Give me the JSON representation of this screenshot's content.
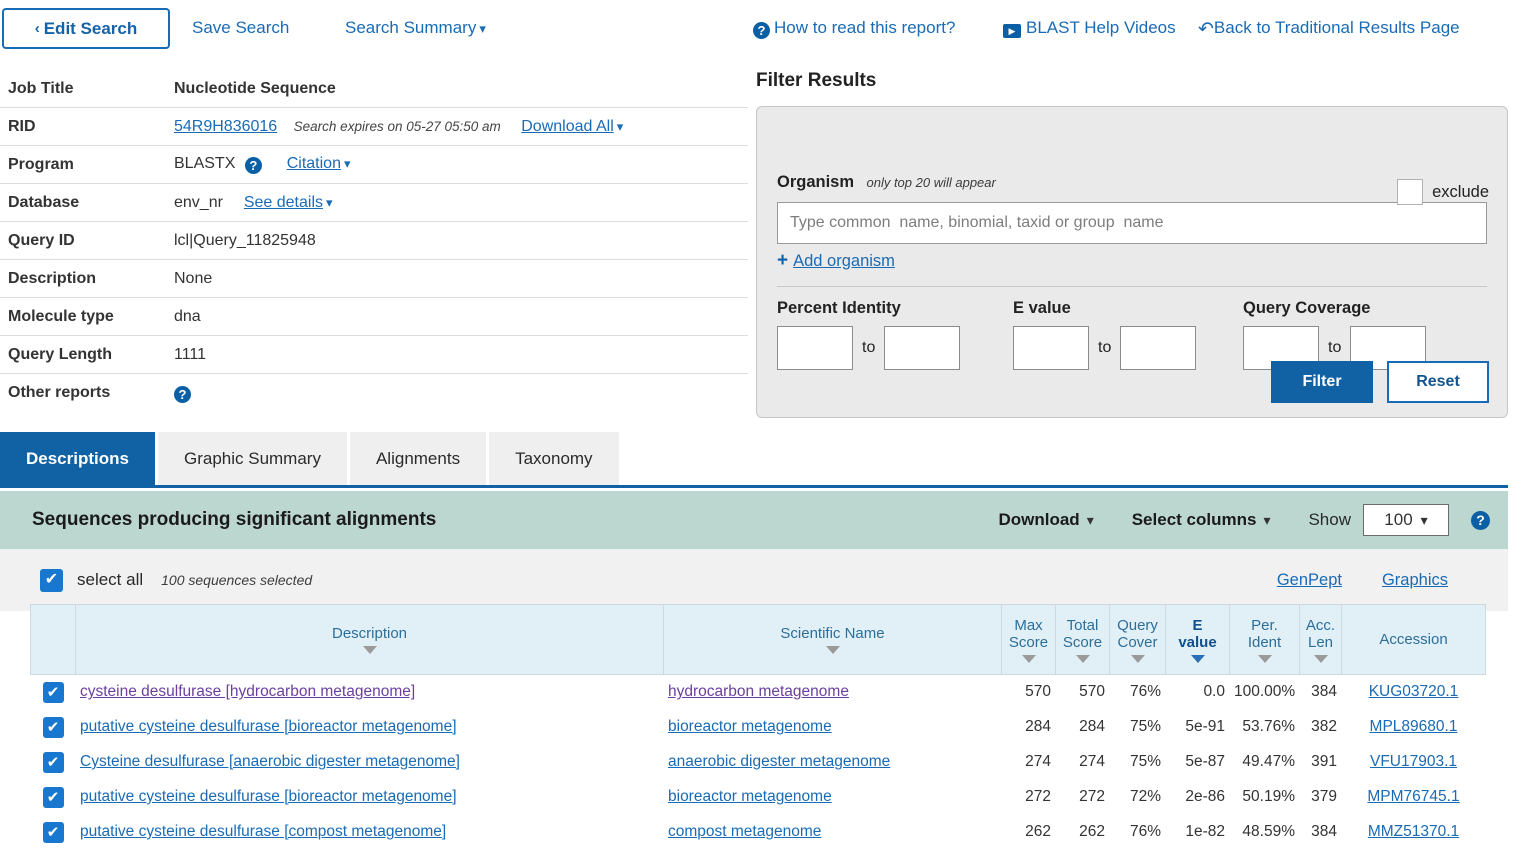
{
  "toolbar": {
    "edit_search": "Edit Search",
    "save_search": "Save Search",
    "search_summary": "Search Summary",
    "how_to_read": "How to read this report?",
    "help_videos": "BLAST Help Videos",
    "back_traditional": "Back to Traditional Results Page",
    "caret": "⌄"
  },
  "summary": {
    "rows": [
      {
        "label": "Job Title",
        "value": "Nucleotide Sequence"
      },
      {
        "label": "RID",
        "value": "54R9H836016",
        "note": "Search expires on 05-27 05:50 am",
        "link": "Download All"
      },
      {
        "label": "Program",
        "value": "BLASTX",
        "link": "Citation"
      },
      {
        "label": "Database",
        "value": "env_nr",
        "link": "See details"
      },
      {
        "label": "Query ID",
        "value": "lcl|Query_11825948"
      },
      {
        "label": "Description",
        "value": "None"
      },
      {
        "label": "Molecule type",
        "value": "dna"
      },
      {
        "label": "Query Length",
        "value": "1111"
      },
      {
        "label": "Other reports",
        "value": ""
      }
    ]
  },
  "filter": {
    "title": "Filter Results",
    "organism_label": "Organism",
    "organism_hint": "only top 20 will appear",
    "organism_placeholder": "Type common  name, binomial, taxid or group  name",
    "organism_value": "",
    "exclude_label": "exclude",
    "add_organism": "Add organism",
    "percent_identity_label": "Percent Identity",
    "evalue_label": "E value",
    "query_coverage_label": "Query Coverage",
    "to_label": "to",
    "pi_from": "",
    "pi_to": "",
    "ev_from": "",
    "ev_to": "",
    "qc_from": "",
    "qc_to": "",
    "filter_button": "Filter",
    "reset_button": "Reset",
    "accent": "#1161a5"
  },
  "tabs": [
    {
      "label": "Descriptions",
      "active": true
    },
    {
      "label": "Graphic Summary",
      "active": false
    },
    {
      "label": "Alignments",
      "active": false
    },
    {
      "label": "Taxonomy",
      "active": false
    }
  ],
  "results_band": {
    "title": "Sequences producing significant alignments",
    "download": "Download",
    "select_columns": "Select columns",
    "show_label": "Show",
    "show_value": "100",
    "band_color": "#bcd6d0"
  },
  "select_strip": {
    "select_all_label": "select all",
    "selected_count": "100 sequences selected",
    "genpept": "GenPept",
    "graphics": "Graphics"
  },
  "table": {
    "columns": [
      {
        "label": "",
        "key": "chk"
      },
      {
        "label": "Description",
        "key": "desc",
        "sortable": true
      },
      {
        "label": "Scientific Name",
        "key": "sci",
        "sortable": true
      },
      {
        "label": "Max\nScore",
        "key": "max",
        "sortable": true
      },
      {
        "label": "Total\nScore",
        "key": "total",
        "sortable": true
      },
      {
        "label": "Query\nCover",
        "key": "cover",
        "sortable": true
      },
      {
        "label": "E\nvalue",
        "key": "evalue",
        "sortable": true,
        "sorted": true
      },
      {
        "label": "Per.\nIdent",
        "key": "ident",
        "sortable": true
      },
      {
        "label": "Acc.\nLen",
        "key": "acclen",
        "sortable": true
      },
      {
        "label": "Accession",
        "key": "accession",
        "sortable": false
      }
    ],
    "column_labels": {
      "description": "Description",
      "scientific_name": "Scientific Name",
      "max_score_1": "Max",
      "max_score_2": "Score",
      "total_score_1": "Total",
      "total_score_2": "Score",
      "query_cover_1": "Query",
      "query_cover_2": "Cover",
      "evalue_1": "E",
      "evalue_2": "value",
      "per_ident_1": "Per.",
      "per_ident_2": "Ident",
      "acc_len_1": "Acc.",
      "acc_len_2": "Len",
      "accession": "Accession"
    },
    "rows": [
      {
        "checked": true,
        "description": "cysteine desulfurase [hydrocarbon metagenome]",
        "scientific_name": "hydrocarbon metagenome",
        "max_score": "570",
        "total_score": "570",
        "query_cover": "76%",
        "evalue": "0.0",
        "per_ident": "100.00%",
        "acc_len": "384",
        "accession": "KUG03720.1",
        "visited": true
      },
      {
        "checked": true,
        "description": "putative cysteine desulfurase [bioreactor metagenome]",
        "scientific_name": "bioreactor metagenome",
        "max_score": "284",
        "total_score": "284",
        "query_cover": "75%",
        "evalue": "5e-91",
        "per_ident": "53.76%",
        "acc_len": "382",
        "accession": "MPL89680.1",
        "visited": false
      },
      {
        "checked": true,
        "description": "Cysteine desulfurase [anaerobic digester metagenome]",
        "scientific_name": "anaerobic digester metagenome",
        "max_score": "274",
        "total_score": "274",
        "query_cover": "75%",
        "evalue": "5e-87",
        "per_ident": "49.47%",
        "acc_len": "391",
        "accession": "VFU17903.1",
        "visited": false
      },
      {
        "checked": true,
        "description": "putative cysteine desulfurase [bioreactor metagenome]",
        "scientific_name": "bioreactor metagenome",
        "max_score": "272",
        "total_score": "272",
        "query_cover": "72%",
        "evalue": "2e-86",
        "per_ident": "50.19%",
        "acc_len": "379",
        "accession": "MPM76745.1",
        "visited": false
      },
      {
        "checked": true,
        "description": "putative cysteine desulfurase [compost metagenome]",
        "scientific_name": "compost metagenome",
        "max_score": "262",
        "total_score": "262",
        "query_cover": "76%",
        "evalue": "1e-82",
        "per_ident": "48.59%",
        "acc_len": "384",
        "accession": "MMZ51370.1",
        "visited": false
      }
    ]
  },
  "icons": {
    "help": "?",
    "play": "▶",
    "undo": "↺",
    "check": "✔",
    "plus": "+",
    "chevron_left": "‹",
    "chevron_down": "⌄"
  }
}
